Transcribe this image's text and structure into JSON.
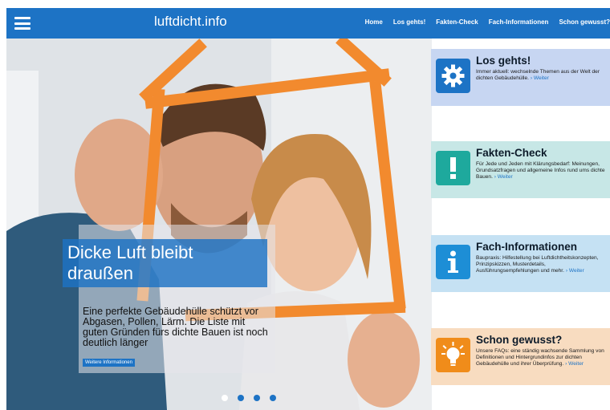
{
  "header": {
    "brand": "luftdicht.info",
    "nav": [
      "Home",
      "Los gehts!",
      "Fakten-Check",
      "Fach-Informationen",
      "Schon gewusst?"
    ]
  },
  "hero": {
    "title": "Dicke Luft bleibt draußen",
    "body": "Eine perfekte Gebäudehülle schützt vor Abgasen, Pollen, Lärm. Die Liste mit guten Gründen fürs dichte Bauen ist noch deutlich länger",
    "button": "Weitere Informationen",
    "slides": 4,
    "active_slide": 1
  },
  "cards": [
    {
      "title": "Los gehts!",
      "desc": "Immer aktuell: wechselnde Themen aus der Welt der dichten Gebäudehülle.",
      "more": "Weiter",
      "icon": "gear-icon",
      "bg": "#c7d6f2",
      "icon_bg": "#1d73c5"
    },
    {
      "title": "Fakten-Check",
      "desc": "Für Jede und Jeden mit Klärungsbedarf: Meinungen, Grundsatzfragen und allgemeine Infos rund ums dichte Bauen.",
      "more": "Weiter",
      "icon": "exclamation-icon",
      "bg": "#c7e7e6",
      "icon_bg": "#1ea99d"
    },
    {
      "title": "Fach-Informationen",
      "desc": "Baupraxis: Hilfestellung bei Luftdichtheitskonzepten, Prinzipskizzen, Musterdetails, Ausführungsempfehlungen und mehr.",
      "more": "Weiter",
      "icon": "info-icon",
      "bg": "#c5e1f3",
      "icon_bg": "#1d8ed6"
    },
    {
      "title": "Schon gewusst?",
      "desc": "Unsere FAQs: eine ständig wachsende Sammlung von Definitionen und Hintergrundinfos zur dichten Gebäudehülle und ihrer Überprüfung.",
      "more": "Weiter",
      "icon": "lightbulb-icon",
      "bg": "#f8dcc0",
      "icon_bg": "#f08c1a"
    }
  ]
}
